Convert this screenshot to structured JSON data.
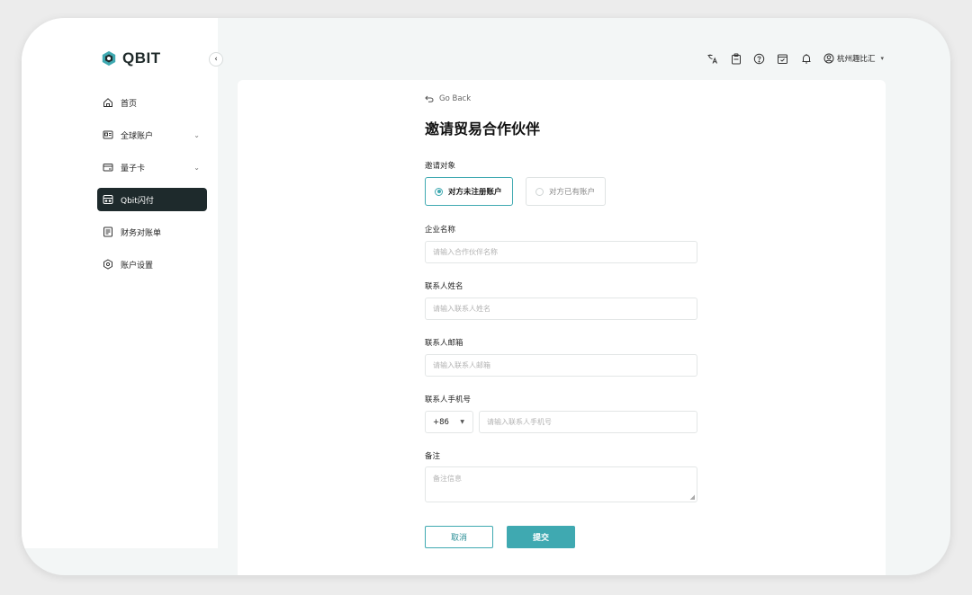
{
  "app": {
    "brand": "QBIT",
    "accent": "#3fa9b1",
    "nav_active_bg": "#1e2a2c"
  },
  "sidebar": {
    "items": [
      {
        "label": "首页",
        "icon": "home-icon",
        "expandable": false,
        "active": false
      },
      {
        "label": "全球账户",
        "icon": "id-card-icon",
        "expandable": true,
        "active": false
      },
      {
        "label": "量子卡",
        "icon": "card-icon",
        "expandable": true,
        "active": false
      },
      {
        "label": "Qbit闪付",
        "icon": "flash-pay-icon",
        "expandable": false,
        "active": true
      },
      {
        "label": "财务对账单",
        "icon": "statement-icon",
        "expandable": false,
        "active": false
      },
      {
        "label": "账户设置",
        "icon": "settings-icon",
        "expandable": false,
        "active": false
      }
    ]
  },
  "topbar": {
    "icons": [
      "translate-icon",
      "clipboard-icon",
      "help-icon",
      "calendar-check-icon",
      "bell-icon"
    ],
    "user_name": "杭州趣比汇"
  },
  "form": {
    "go_back": "Go Back",
    "title": "邀请贸易合作伙伴",
    "invite_target_label": "邀请对象",
    "option_unregistered": "对方未注册账户",
    "option_registered": "对方已有账户",
    "selected_option": "对方未注册账户",
    "company_label": "企业名称",
    "company_placeholder": "请输入合作伙伴名称",
    "contact_name_label": "联系人姓名",
    "contact_name_placeholder": "请输入联系人姓名",
    "contact_email_label": "联系人邮箱",
    "contact_email_placeholder": "请输入联系人邮箱",
    "contact_phone_label": "联系人手机号",
    "phone_code": "+86",
    "contact_phone_placeholder": "请输入联系人手机号",
    "note_label": "备注",
    "note_placeholder": "备注信息",
    "cancel_label": "取消",
    "submit_label": "提交"
  }
}
